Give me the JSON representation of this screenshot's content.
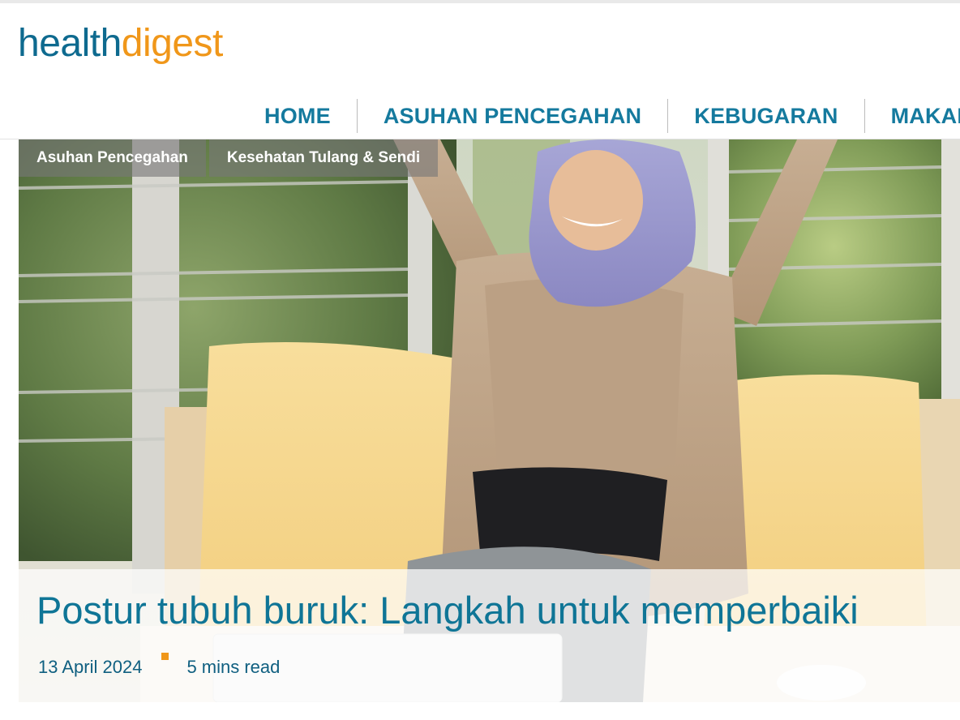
{
  "brand": {
    "logo_part1": "health",
    "logo_part2": "digest"
  },
  "nav": {
    "items": [
      {
        "label": "HOME"
      },
      {
        "label": "ASUHAN PENCEGAHAN"
      },
      {
        "label": "KEBUGARAN"
      },
      {
        "label": "MAKAN"
      }
    ]
  },
  "article": {
    "tags": [
      {
        "label": "Asuhan Pencegahan"
      },
      {
        "label": "Kesehatan Tulang & Sendi"
      }
    ],
    "title": "Postur tubuh buruk: Langkah untuk memperbaiki",
    "date": "13 April 2024",
    "read_time": "5 mins read"
  },
  "colors": {
    "brand_blue": "#0e6a8f",
    "brand_orange": "#f0971a",
    "nav_text": "#157a9e",
    "title_text": "#0f7596"
  }
}
